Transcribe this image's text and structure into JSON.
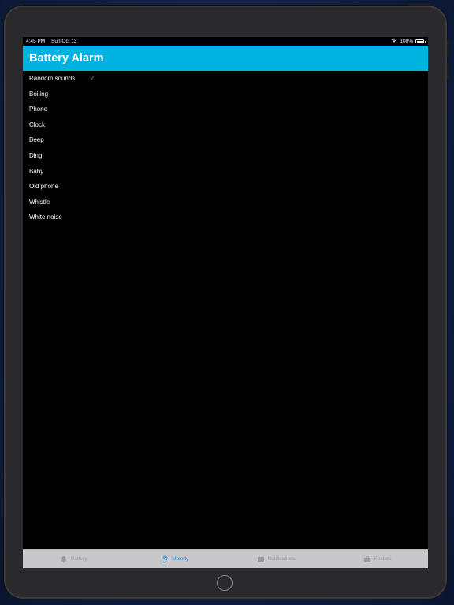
{
  "status_bar": {
    "time": "4:45 PM",
    "date": "Sun Oct 13",
    "battery_text": "100%",
    "battery_level": 1.0,
    "wifi_icon": "wifi-icon",
    "battery_icon": "battery-icon"
  },
  "header": {
    "title": "Battery Alarm",
    "background_color": "#00b2e0"
  },
  "melodies": [
    {
      "label": "Random sounds",
      "selected": true
    },
    {
      "label": "Boiling",
      "selected": false
    },
    {
      "label": "Phone",
      "selected": false
    },
    {
      "label": "Clock",
      "selected": false
    },
    {
      "label": "Beep",
      "selected": false
    },
    {
      "label": "Ding",
      "selected": false
    },
    {
      "label": "Baby",
      "selected": false
    },
    {
      "label": "Old phone",
      "selected": false
    },
    {
      "label": "Whistle",
      "selected": false
    },
    {
      "label": "White noise",
      "selected": false
    }
  ],
  "selected_check_icon": "checkmark-icon",
  "tabs": [
    {
      "label": "Battery",
      "icon": "bell-icon",
      "active": false
    },
    {
      "label": "Melody",
      "icon": "ear-icon",
      "active": true
    },
    {
      "label": "Notifications",
      "icon": "calendar-icon",
      "active": false
    },
    {
      "label": "Folders",
      "icon": "briefcase-icon",
      "active": false
    }
  ],
  "colors": {
    "active_tab": "#1a8fe0",
    "inactive_tab": "#9a9a9e",
    "checkmark": "#34c759"
  }
}
